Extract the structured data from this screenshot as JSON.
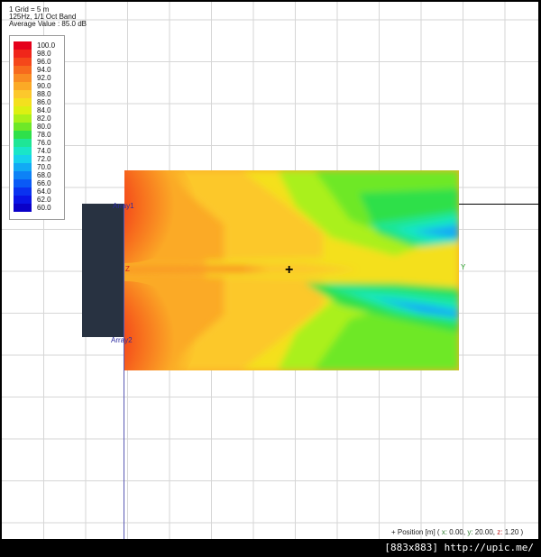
{
  "info": {
    "grid": "1 Grid = 5 m",
    "band": "125Hz, 1/1 Oct Band",
    "average": "Average Value : 85.0 dB"
  },
  "legend": {
    "items": [
      {
        "label": "100.0",
        "color": "#e5001a"
      },
      {
        "label": "98.0",
        "color": "#f0261a"
      },
      {
        "label": "96.0",
        "color": "#f5471a"
      },
      {
        "label": "94.0",
        "color": "#f76a1d"
      },
      {
        "label": "92.0",
        "color": "#f98c22"
      },
      {
        "label": "90.0",
        "color": "#fbaa26"
      },
      {
        "label": "88.0",
        "color": "#fcc82c"
      },
      {
        "label": "86.0",
        "color": "#f4e01e"
      },
      {
        "label": "84.0",
        "color": "#dcf012"
      },
      {
        "label": "82.0",
        "color": "#aaf01a"
      },
      {
        "label": "80.0",
        "color": "#6ee828"
      },
      {
        "label": "78.0",
        "color": "#2ee04a"
      },
      {
        "label": "76.0",
        "color": "#1ee696"
      },
      {
        "label": "74.0",
        "color": "#19e6c8"
      },
      {
        "label": "72.0",
        "color": "#16d2ec"
      },
      {
        "label": "70.0",
        "color": "#12aaf4"
      },
      {
        "label": "68.0",
        "color": "#0d82f6"
      },
      {
        "label": "66.0",
        "color": "#0a5af6"
      },
      {
        "label": "64.0",
        "color": "#0a32f0"
      },
      {
        "label": "62.0",
        "color": "#0a14e6"
      },
      {
        "label": "60.0",
        "color": "#0a00c8"
      }
    ]
  },
  "markers": {
    "top": "Array1",
    "bottom": "Array2",
    "y_axis": "Y",
    "z_axis": "Z",
    "crosshair": "+"
  },
  "status": {
    "prefix": "+ Position [m] (",
    "x_key": "x:",
    "x_val": "0.00,",
    "y_key": "y:",
    "y_val": "20.00,",
    "z_key": "z:",
    "z_val": "1.20",
    "suffix": ")"
  },
  "watermark": "[883x883] http://upic.me/"
}
